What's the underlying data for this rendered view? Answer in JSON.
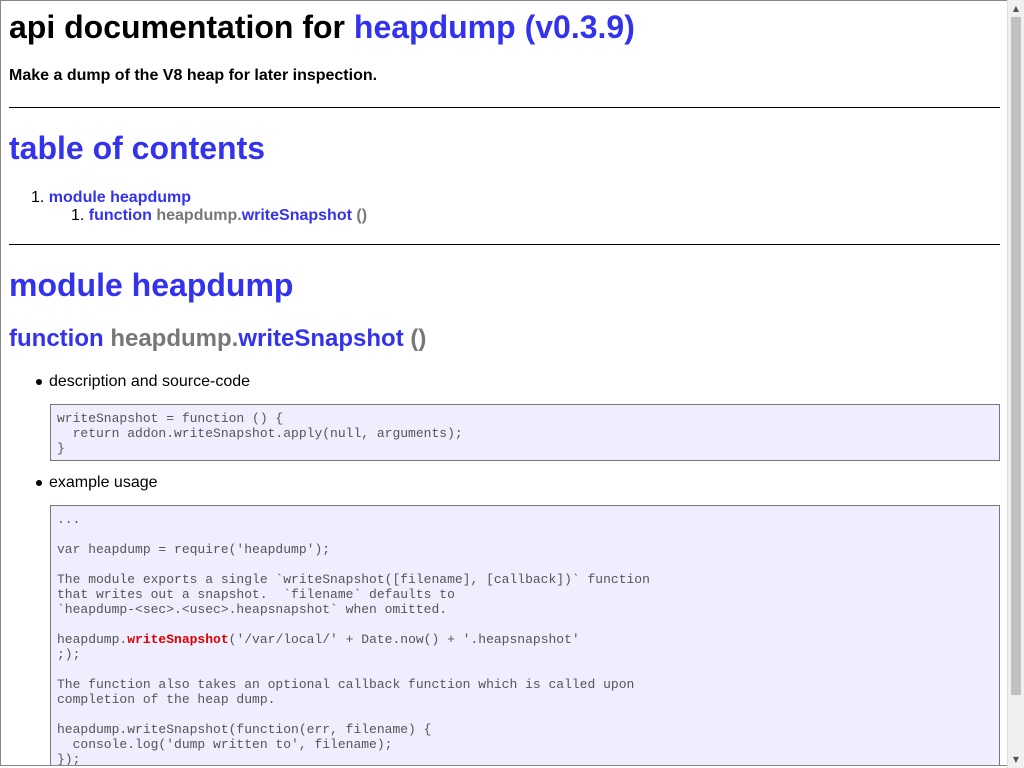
{
  "title": {
    "prefix": "api documentation for",
    "package_link": "heapdump (v0.3.9)"
  },
  "description": "Make a dump of the V8 heap for later inspection.",
  "toc": {
    "heading": "table of contents",
    "items": [
      {
        "number": "1.",
        "label": "module heapdump"
      }
    ],
    "subitems": [
      {
        "number": "1.",
        "keyword": "function",
        "owner": "heapdump.",
        "name": "writeSnapshot",
        "args": "()"
      }
    ]
  },
  "module": {
    "heading": "module heapdump",
    "function": {
      "keyword": "function",
      "owner": "heapdump.",
      "name": "writeSnapshot",
      "args": "()"
    }
  },
  "sections": {
    "source_label": "description and source-code",
    "source_code": "writeSnapshot = function () {\n  return addon.writeSnapshot.apply(null, arguments);\n}",
    "example_label": "example usage",
    "example_code": {
      "before": "...\n\nvar heapdump = require('heapdump');\n\nThe module exports a single `writeSnapshot([filename], [callback])` function\nthat writes out a snapshot.  `filename` defaults to\n`heapdump-<sec>.<usec>.heapsnapshot` when omitted.\n\nheapdump.",
      "highlight": "writeSnapshot",
      "after": "('/var/local/' + Date.now() + '.heapsnapshot'\n;);\n\nThe function also takes an optional callback function which is called upon\ncompletion of the heap dump.\n\nheapdump.writeSnapshot(function(err, filename) {\n  console.log('dump written to', filename);\n});"
    }
  },
  "scrollbar": {
    "up_icon": "scroll-up-arrow-icon",
    "down_icon": "scroll-down-arrow-icon"
  },
  "colors": {
    "link": "#3333ee",
    "muted": "#777777",
    "code_bg": "#eeeeff",
    "highlight": "#dd0000"
  }
}
